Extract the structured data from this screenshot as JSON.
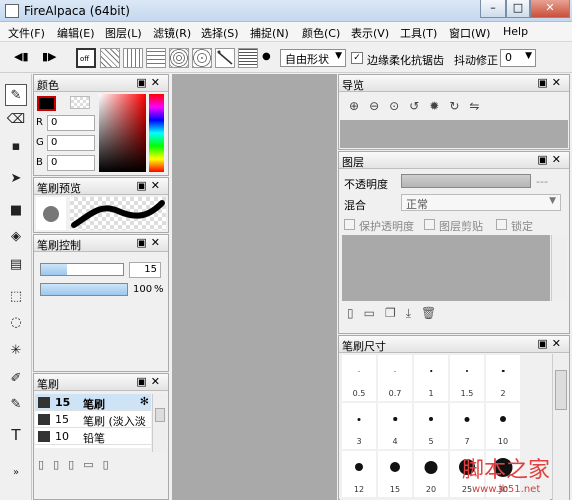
{
  "window": {
    "title": "FireAlpaca (64bit)"
  },
  "menu": [
    "文件(F)",
    "编辑(E)",
    "图层(L)",
    "滤镜(R)",
    "选择(S)",
    "捕捉(N)",
    "颜色(C)",
    "表示(V)",
    "工具(T)",
    "窗口(W)",
    "Help"
  ],
  "toolbar": {
    "off_label": "off",
    "shape_select": "自由形状",
    "antialias_label": "边缘柔化抗锯齿",
    "stabilizer_label": "抖动修正",
    "stabilizer_value": "0"
  },
  "color_panel": {
    "title": "颜色",
    "r_label": "R",
    "g_label": "G",
    "b_label": "B",
    "r": "0",
    "g": "0",
    "b": "0"
  },
  "brush_preview_panel": {
    "title": "笔刷预览"
  },
  "brush_control_panel": {
    "title": "笔刷控制",
    "size": "15",
    "opacity": "100",
    "opacity_unit": "%"
  },
  "brush_panel": {
    "title": "笔刷",
    "items": [
      {
        "size": "15",
        "name": "笔刷"
      },
      {
        "size": "15",
        "name": "笔刷 (淡入淡"
      },
      {
        "size": "10",
        "name": "铅笔"
      }
    ]
  },
  "navigator_panel": {
    "title": "导览"
  },
  "layer_panel": {
    "title": "图层",
    "opacity_label": "不透明度",
    "opacity_dashes": "---",
    "blend_label": "混合",
    "blend_value": "正常",
    "protect_label": "保护透明度",
    "clip_label": "图层剪贴",
    "lock_label": "锁定"
  },
  "brush_size_panel": {
    "title": "笔刷尺寸",
    "sizes": [
      "0.5",
      "0.7",
      "1",
      "1.5",
      "2",
      "3",
      "4",
      "5",
      "7",
      "10",
      "12",
      "15",
      "20",
      "25",
      "30"
    ]
  },
  "watermark": {
    "text": "脚本之家",
    "url": "www.jb51.net"
  }
}
